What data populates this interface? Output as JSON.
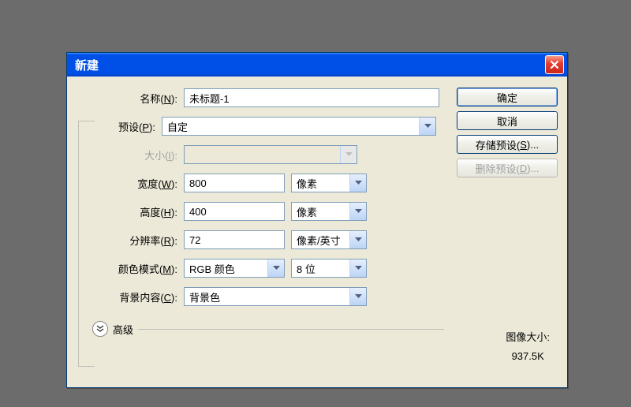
{
  "title": "新建",
  "fields": {
    "name_label_pre": "名称(",
    "name_key": "N",
    "name_label_post": "):",
    "name_value": "未标题-1",
    "preset_label_pre": "预设(",
    "preset_key": "P",
    "preset_label_post": "):",
    "preset_value": "自定",
    "size_label_pre": "大小(",
    "size_key": "I",
    "size_label_post": "):",
    "size_value": "",
    "width_label_pre": "宽度(",
    "width_key": "W",
    "width_label_post": "):",
    "width_value": "800",
    "width_unit": "像素",
    "height_label_pre": "高度(",
    "height_key": "H",
    "height_label_post": "):",
    "height_value": "400",
    "height_unit": "像素",
    "res_label_pre": "分辨率(",
    "res_key": "R",
    "res_label_post": "):",
    "res_value": "72",
    "res_unit": "像素/英寸",
    "mode_label_pre": "颜色模式(",
    "mode_key": "M",
    "mode_label_post": "):",
    "mode_value": "RGB 颜色",
    "mode_depth": "8 位",
    "bg_label_pre": "背景内容(",
    "bg_key": "C",
    "bg_label_post": "):",
    "bg_value": "背景色",
    "advanced_label": "高级"
  },
  "buttons": {
    "ok": "确定",
    "cancel": "取消",
    "save_preset_pre": "存储预设(",
    "save_preset_key": "S",
    "save_preset_post": ")...",
    "delete_preset_pre": "删除预设(",
    "delete_preset_key": "D",
    "delete_preset_post": ")..."
  },
  "image_size": {
    "label": "图像大小:",
    "value": "937.5K"
  }
}
